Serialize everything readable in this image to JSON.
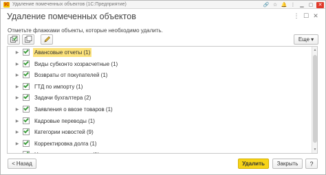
{
  "app": {
    "logo_text": "1С",
    "window_title": "Удаление помеченных объектов (1С:Предприятие)",
    "controls": {
      "link": "🔗",
      "star": "☆",
      "bell": "🔔",
      "menu": "⋮",
      "minimize": "▁",
      "maximize": "▢",
      "close": "✕"
    }
  },
  "form": {
    "title": "Удаление помеченных объектов",
    "header_buttons": {
      "more": "⋮",
      "maximize": "☐",
      "close": "✕"
    },
    "prompt": "Отметьте флажками объекты, которые необходимо удалить."
  },
  "toolbar": {
    "check_all_icon": "check-all-icon",
    "uncheck_all_icon": "uncheck-all-icon",
    "edit_icon": "pencil-icon",
    "more_label": "Еще",
    "more_arrow": "▾"
  },
  "list": {
    "expander_glyph": "▶",
    "items": [
      {
        "label": "Авансовые отчеты (1)",
        "checked": true,
        "selected": true
      },
      {
        "label": "Виды субконто хозрасчетные (1)",
        "checked": true,
        "selected": false
      },
      {
        "label": "Возвраты от покупателей (1)",
        "checked": true,
        "selected": false
      },
      {
        "label": "ГТД по импорту (1)",
        "checked": true,
        "selected": false
      },
      {
        "label": "Задачи бухгалтера (2)",
        "checked": true,
        "selected": false
      },
      {
        "label": "Заявления о ввозе товаров (1)",
        "checked": true,
        "selected": false
      },
      {
        "label": "Кадровые переводы (1)",
        "checked": true,
        "selected": false
      },
      {
        "label": "Категории новостей (9)",
        "checked": true,
        "selected": false
      },
      {
        "label": "Корректировка долга (1)",
        "checked": true,
        "selected": false
      },
      {
        "label": "Начисления зарплаты (1)",
        "checked": true,
        "selected": false
      }
    ],
    "scroll_up": "▲",
    "scroll_down": "▼"
  },
  "footer": {
    "back_arrow": "<",
    "back_label": "Назад",
    "delete_label": "Удалить",
    "close_label": "Закрыть",
    "help_label": "?"
  },
  "colors": {
    "accent": "#f7d417",
    "selection": "#fbe17a",
    "check": "#3d9e3d",
    "close_red": "#e0392a"
  }
}
